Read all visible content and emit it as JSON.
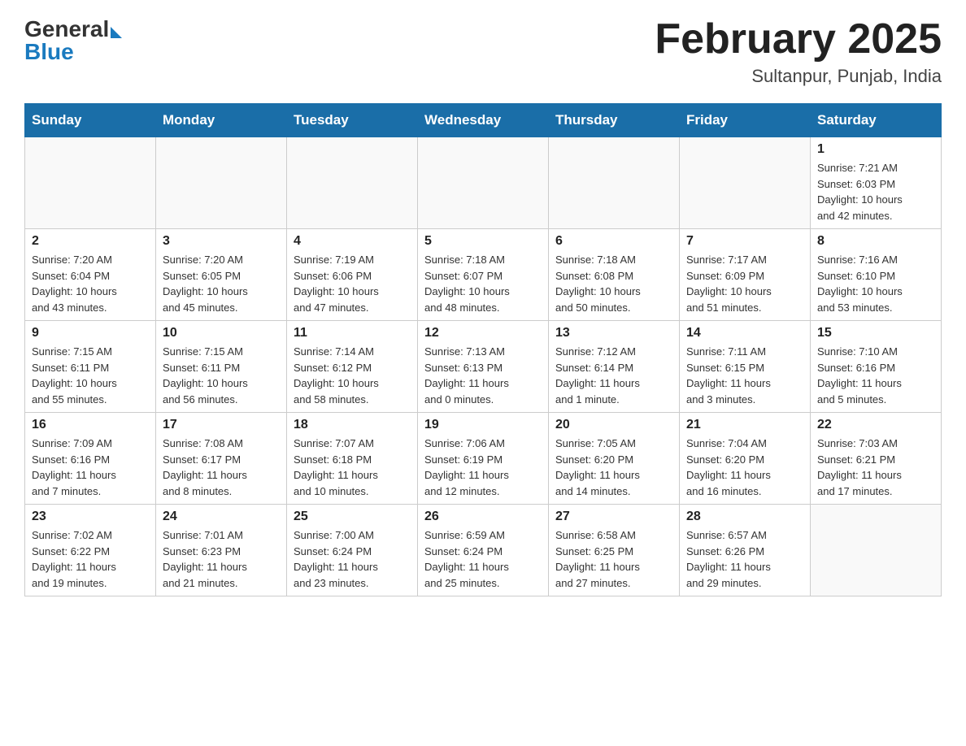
{
  "header": {
    "logo_general": "General",
    "logo_blue": "Blue",
    "month_title": "February 2025",
    "location": "Sultanpur, Punjab, India"
  },
  "weekdays": [
    "Sunday",
    "Monday",
    "Tuesday",
    "Wednesday",
    "Thursday",
    "Friday",
    "Saturday"
  ],
  "weeks": [
    [
      {
        "day": "",
        "info": ""
      },
      {
        "day": "",
        "info": ""
      },
      {
        "day": "",
        "info": ""
      },
      {
        "day": "",
        "info": ""
      },
      {
        "day": "",
        "info": ""
      },
      {
        "day": "",
        "info": ""
      },
      {
        "day": "1",
        "info": "Sunrise: 7:21 AM\nSunset: 6:03 PM\nDaylight: 10 hours\nand 42 minutes."
      }
    ],
    [
      {
        "day": "2",
        "info": "Sunrise: 7:20 AM\nSunset: 6:04 PM\nDaylight: 10 hours\nand 43 minutes."
      },
      {
        "day": "3",
        "info": "Sunrise: 7:20 AM\nSunset: 6:05 PM\nDaylight: 10 hours\nand 45 minutes."
      },
      {
        "day": "4",
        "info": "Sunrise: 7:19 AM\nSunset: 6:06 PM\nDaylight: 10 hours\nand 47 minutes."
      },
      {
        "day": "5",
        "info": "Sunrise: 7:18 AM\nSunset: 6:07 PM\nDaylight: 10 hours\nand 48 minutes."
      },
      {
        "day": "6",
        "info": "Sunrise: 7:18 AM\nSunset: 6:08 PM\nDaylight: 10 hours\nand 50 minutes."
      },
      {
        "day": "7",
        "info": "Sunrise: 7:17 AM\nSunset: 6:09 PM\nDaylight: 10 hours\nand 51 minutes."
      },
      {
        "day": "8",
        "info": "Sunrise: 7:16 AM\nSunset: 6:10 PM\nDaylight: 10 hours\nand 53 minutes."
      }
    ],
    [
      {
        "day": "9",
        "info": "Sunrise: 7:15 AM\nSunset: 6:11 PM\nDaylight: 10 hours\nand 55 minutes."
      },
      {
        "day": "10",
        "info": "Sunrise: 7:15 AM\nSunset: 6:11 PM\nDaylight: 10 hours\nand 56 minutes."
      },
      {
        "day": "11",
        "info": "Sunrise: 7:14 AM\nSunset: 6:12 PM\nDaylight: 10 hours\nand 58 minutes."
      },
      {
        "day": "12",
        "info": "Sunrise: 7:13 AM\nSunset: 6:13 PM\nDaylight: 11 hours\nand 0 minutes."
      },
      {
        "day": "13",
        "info": "Sunrise: 7:12 AM\nSunset: 6:14 PM\nDaylight: 11 hours\nand 1 minute."
      },
      {
        "day": "14",
        "info": "Sunrise: 7:11 AM\nSunset: 6:15 PM\nDaylight: 11 hours\nand 3 minutes."
      },
      {
        "day": "15",
        "info": "Sunrise: 7:10 AM\nSunset: 6:16 PM\nDaylight: 11 hours\nand 5 minutes."
      }
    ],
    [
      {
        "day": "16",
        "info": "Sunrise: 7:09 AM\nSunset: 6:16 PM\nDaylight: 11 hours\nand 7 minutes."
      },
      {
        "day": "17",
        "info": "Sunrise: 7:08 AM\nSunset: 6:17 PM\nDaylight: 11 hours\nand 8 minutes."
      },
      {
        "day": "18",
        "info": "Sunrise: 7:07 AM\nSunset: 6:18 PM\nDaylight: 11 hours\nand 10 minutes."
      },
      {
        "day": "19",
        "info": "Sunrise: 7:06 AM\nSunset: 6:19 PM\nDaylight: 11 hours\nand 12 minutes."
      },
      {
        "day": "20",
        "info": "Sunrise: 7:05 AM\nSunset: 6:20 PM\nDaylight: 11 hours\nand 14 minutes."
      },
      {
        "day": "21",
        "info": "Sunrise: 7:04 AM\nSunset: 6:20 PM\nDaylight: 11 hours\nand 16 minutes."
      },
      {
        "day": "22",
        "info": "Sunrise: 7:03 AM\nSunset: 6:21 PM\nDaylight: 11 hours\nand 17 minutes."
      }
    ],
    [
      {
        "day": "23",
        "info": "Sunrise: 7:02 AM\nSunset: 6:22 PM\nDaylight: 11 hours\nand 19 minutes."
      },
      {
        "day": "24",
        "info": "Sunrise: 7:01 AM\nSunset: 6:23 PM\nDaylight: 11 hours\nand 21 minutes."
      },
      {
        "day": "25",
        "info": "Sunrise: 7:00 AM\nSunset: 6:24 PM\nDaylight: 11 hours\nand 23 minutes."
      },
      {
        "day": "26",
        "info": "Sunrise: 6:59 AM\nSunset: 6:24 PM\nDaylight: 11 hours\nand 25 minutes."
      },
      {
        "day": "27",
        "info": "Sunrise: 6:58 AM\nSunset: 6:25 PM\nDaylight: 11 hours\nand 27 minutes."
      },
      {
        "day": "28",
        "info": "Sunrise: 6:57 AM\nSunset: 6:26 PM\nDaylight: 11 hours\nand 29 minutes."
      },
      {
        "day": "",
        "info": ""
      }
    ]
  ]
}
